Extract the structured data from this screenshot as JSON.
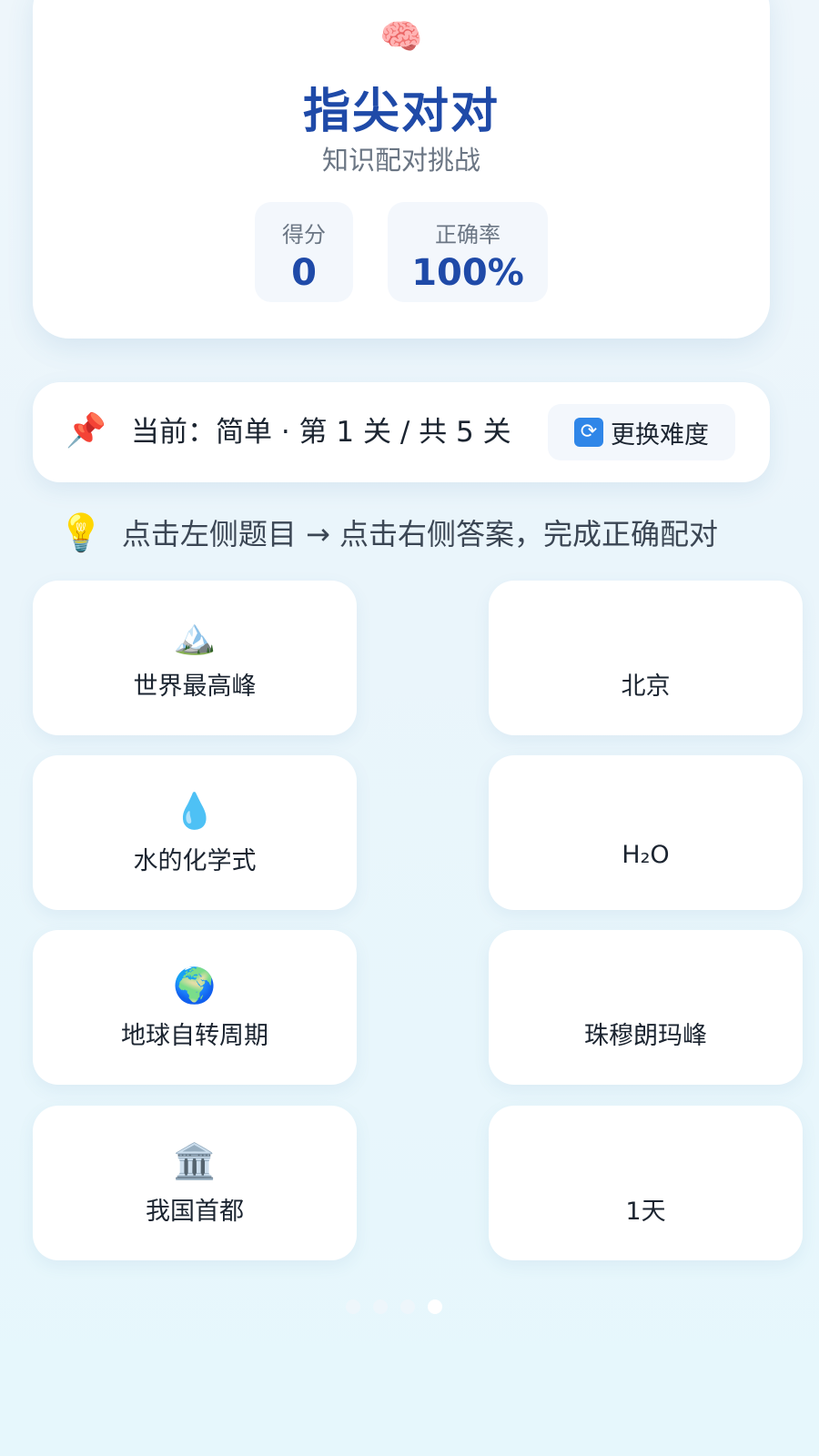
{
  "header": {
    "icon": "brain-icon",
    "title": "指尖对对",
    "subtitle": "知识配对挑战",
    "stats": {
      "score_label": "得分",
      "score_value": "0",
      "accuracy_label": "正确率",
      "accuracy_value": "100%"
    }
  },
  "level": {
    "icon": "pin-icon",
    "text": "当前：简单 · 第 1 关 / 共 5 关",
    "change_button_label": "更换难度",
    "change_button_icon": "refresh-icon"
  },
  "hint": {
    "icon": "lightbulb-icon",
    "text": "点击左侧题目 → 点击右侧答案，完成正确配对"
  },
  "questions": [
    {
      "icon": "mountain-icon",
      "text": "世界最高峰"
    },
    {
      "icon": "droplet-icon",
      "text": "水的化学式"
    },
    {
      "icon": "globe-icon",
      "text": "地球自转周期"
    },
    {
      "icon": "building-icon",
      "text": "我国首都"
    }
  ],
  "answers": [
    {
      "text": "北京"
    },
    {
      "text": "H₂O"
    },
    {
      "text": "珠穆朗玛峰"
    },
    {
      "text": "1天"
    }
  ],
  "pagination": {
    "count": 4,
    "active_index": 3
  }
}
